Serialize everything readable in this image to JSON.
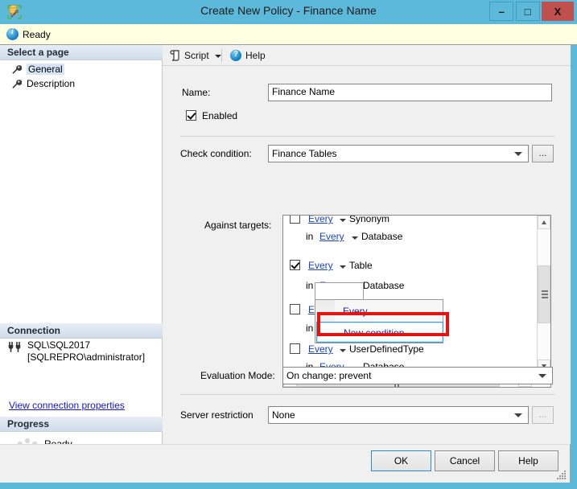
{
  "window": {
    "title": "Create New Policy - Finance Name",
    "icon": "policy-icon",
    "minimize": "–",
    "maximize": "□",
    "close": "X"
  },
  "status": {
    "icon": "info-icon",
    "text": "Ready"
  },
  "sidebar": {
    "header": "Select a page",
    "items": [
      {
        "label": "General",
        "icon": "wrench-icon",
        "selected": true
      },
      {
        "label": "Description",
        "icon": "wrench-icon",
        "selected": false
      }
    ],
    "connection": {
      "header": "Connection",
      "icon": "connection-icon",
      "server": "SQL\\SQL2017",
      "user": "[SQLREPRO\\administrator]",
      "link": "View connection properties"
    },
    "progress": {
      "header": "Progress",
      "icon": "spinner-icon",
      "text": "Ready"
    }
  },
  "toolbar": {
    "script_label": "Script",
    "script_icon": "script-icon",
    "script_caret": "chevron-down-icon",
    "help_label": "Help",
    "help_icon": "help-icon"
  },
  "form": {
    "name_label": "Name:",
    "name_value": "Finance Name",
    "enabled_label": "Enabled",
    "enabled_checked": true,
    "check_condition_label": "Check condition:",
    "check_condition_value": "Finance Tables",
    "check_condition_browse": "...",
    "against_targets_label": "Against targets:",
    "evaluation_mode_label": "Evaluation Mode:",
    "evaluation_mode_value": "On change: prevent",
    "server_restriction_label": "Server restriction",
    "server_restriction_value": "None",
    "server_restriction_browse": "..."
  },
  "targets": {
    "rows": [
      {
        "indent": "outer",
        "checked": false,
        "link": "Every",
        "text": "Synonym",
        "prefix": "",
        "clipped": true
      },
      {
        "indent": "inner",
        "checked": null,
        "link": "Every",
        "text": "Database",
        "prefix": "in",
        "clipped": false
      },
      {
        "indent": "outer",
        "checked": true,
        "link": "Every",
        "text": "Table",
        "prefix": "",
        "clipped": false
      },
      {
        "indent": "inner",
        "checked": null,
        "link": "Every",
        "text": "Database",
        "prefix": "in",
        "clipped": false
      },
      {
        "indent": "outer",
        "checked": false,
        "link": "Every",
        "text": "",
        "prefix": "",
        "clipped": false
      },
      {
        "indent": "inner",
        "checked": null,
        "link": "",
        "text": "",
        "prefix": "in",
        "clipped": false
      },
      {
        "indent": "outer",
        "checked": false,
        "link": "Every",
        "text": "UserDefinedType",
        "prefix": "",
        "clipped": false
      },
      {
        "indent": "inner",
        "checked": null,
        "link": "Every",
        "text": "Database",
        "prefix": "in",
        "clipped": false
      }
    ],
    "dropdown": {
      "open_value": "Every",
      "items": [
        {
          "label": "Every",
          "highlighted": false
        },
        {
          "label": "New condition...",
          "highlighted": true
        }
      ]
    }
  },
  "buttons": {
    "ok": "OK",
    "cancel": "Cancel",
    "help": "Help"
  },
  "colors": {
    "title_bar": "#5cb9d9",
    "close_button": "#c0504d",
    "info_bar": "#ffffe1",
    "link": "#1414e0",
    "annotation": "#e8130f",
    "highlight_border": "#3c9ddb"
  }
}
